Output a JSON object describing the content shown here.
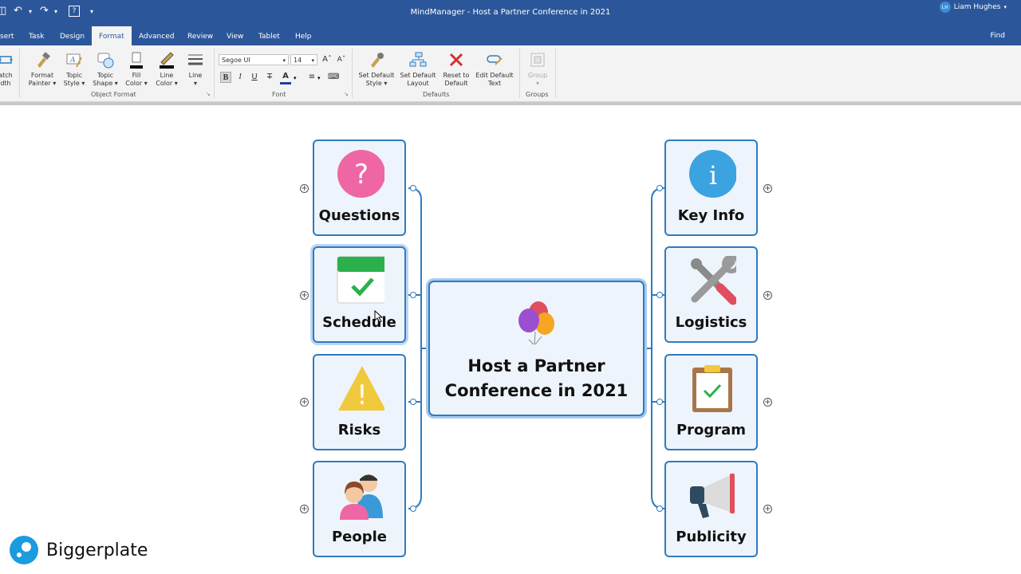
{
  "window": {
    "title": "MindManager - Host a Partner Conference in 2021",
    "user_name": "Liam Hughes",
    "user_initials": "LH"
  },
  "tabs": [
    {
      "label": "sert"
    },
    {
      "label": "Task"
    },
    {
      "label": "Design"
    },
    {
      "label": "Format",
      "active": true
    },
    {
      "label": "Advanced"
    },
    {
      "label": "Review"
    },
    {
      "label": "View"
    },
    {
      "label": "Tablet"
    },
    {
      "label": "Help"
    }
  ],
  "find_label": "Find",
  "ribbon": {
    "match_width": {
      "line1": "atch",
      "line2": "dth"
    },
    "format_painter": {
      "line1": "Format",
      "line2": "Painter"
    },
    "topic_style": {
      "line1": "Topic",
      "line2": "Style"
    },
    "topic_shape": {
      "line1": "Topic",
      "line2": "Shape"
    },
    "fill_color": {
      "line1": "Fill",
      "line2": "Color"
    },
    "line_color": {
      "line1": "Line",
      "line2": "Color"
    },
    "line": {
      "line1": "Line"
    },
    "object_format_label": "Object Format",
    "font_name": "Segoe UI",
    "font_size": "14",
    "font_label": "Font",
    "set_default_style": {
      "line1": "Set Default",
      "line2": "Style"
    },
    "set_default_layout": {
      "line1": "Set Default",
      "line2": "Layout"
    },
    "reset_to_default": {
      "line1": "Reset to",
      "line2": "Default"
    },
    "edit_default_text": {
      "line1": "Edit Default",
      "line2": "Text"
    },
    "defaults_label": "Defaults",
    "group": {
      "line1": "Group"
    },
    "groups_label": "Groups"
  },
  "map": {
    "central": {
      "line1": "Host a Partner",
      "line2": "Conference in 2021",
      "icon": "balloons-icon"
    },
    "left_topics": [
      {
        "label": "Questions",
        "icon": "question-icon"
      },
      {
        "label": "Schedule",
        "icon": "calendar-check-icon"
      },
      {
        "label": "Risks",
        "icon": "warning-icon"
      },
      {
        "label": "People",
        "icon": "people-icon"
      }
    ],
    "right_topics": [
      {
        "label": "Key Info",
        "icon": "info-icon"
      },
      {
        "label": "Logistics",
        "icon": "tools-icon"
      },
      {
        "label": "Program",
        "icon": "clipboard-check-icon"
      },
      {
        "label": "Publicity",
        "icon": "megaphone-icon"
      }
    ]
  },
  "watermark": {
    "text": "Biggerplate"
  },
  "colors": {
    "accent": "#2b579a",
    "topic_border": "#2f7bbf",
    "topic_fill": "#eef4fb"
  }
}
